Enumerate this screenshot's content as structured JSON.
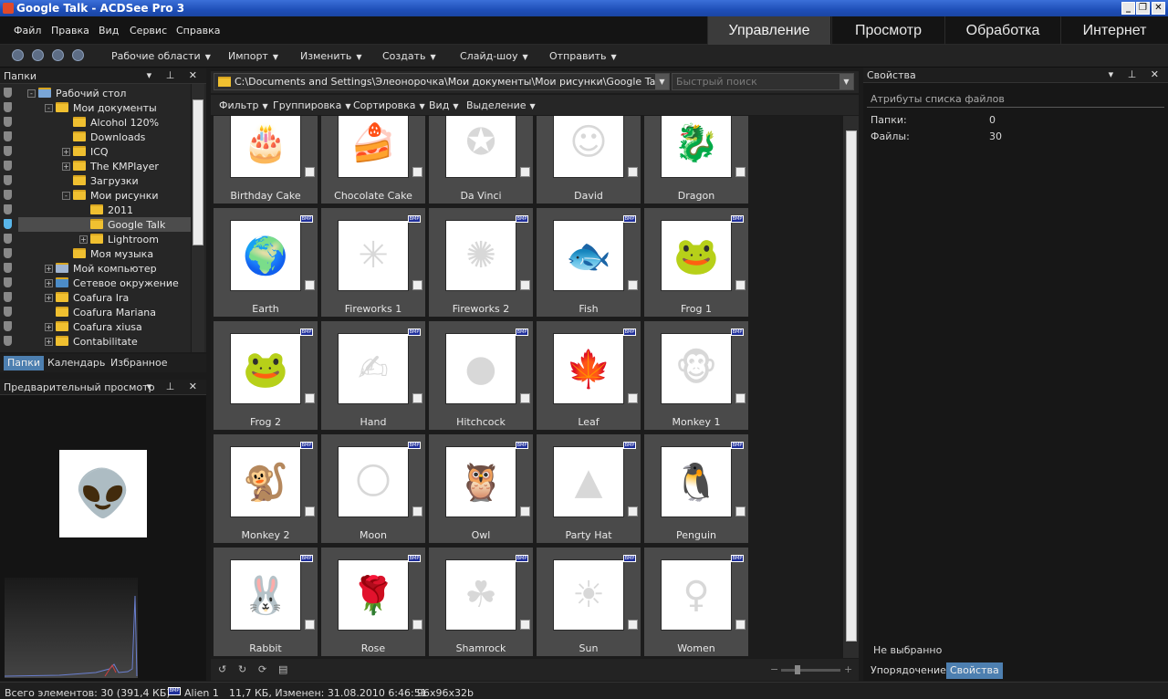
{
  "window": {
    "title": "Google Talk - ACDSee Pro 3"
  },
  "menu": [
    "Файл",
    "Правка",
    "Вид",
    "Сервис",
    "Справка"
  ],
  "modes": [
    "Управление",
    "Просмотр",
    "Обработка",
    "Интернет"
  ],
  "toolbar": [
    "Рабочие области",
    "Импорт",
    "Изменить",
    "Создать",
    "Слайд-шоу",
    "Отправить"
  ],
  "folders_panel": {
    "title": "Папки",
    "tree": [
      {
        "label": "Рабочий стол",
        "level": 0,
        "expander": "-",
        "icon": "desktop"
      },
      {
        "label": "Мои документы",
        "level": 1,
        "expander": "-",
        "icon": "docs"
      },
      {
        "label": "Alcohol 120%",
        "level": 2,
        "expander": "",
        "icon": "folder"
      },
      {
        "label": "Downloads",
        "level": 2,
        "expander": "",
        "icon": "folder"
      },
      {
        "label": "ICQ",
        "level": 2,
        "expander": "+",
        "icon": "folder"
      },
      {
        "label": "The KMPlayer",
        "level": 2,
        "expander": "+",
        "icon": "folder"
      },
      {
        "label": "Загрузки",
        "level": 2,
        "expander": "",
        "icon": "folder"
      },
      {
        "label": "Мои рисунки",
        "level": 2,
        "expander": "-",
        "icon": "pics"
      },
      {
        "label": "2011",
        "level": 3,
        "expander": "",
        "icon": "folder"
      },
      {
        "label": "Google Talk",
        "level": 3,
        "expander": "",
        "icon": "folder",
        "selected": true
      },
      {
        "label": "Lightroom",
        "level": 3,
        "expander": "+",
        "icon": "folder"
      },
      {
        "label": "Моя музыка",
        "level": 2,
        "expander": "",
        "icon": "music"
      },
      {
        "label": "Мой компьютер",
        "level": 1,
        "expander": "+",
        "icon": "computer"
      },
      {
        "label": "Сетевое окружение",
        "level": 1,
        "expander": "+",
        "icon": "network"
      },
      {
        "label": "Coafura Ira",
        "level": 1,
        "expander": "+",
        "icon": "folder"
      },
      {
        "label": "Coafura Mariana",
        "level": 1,
        "expander": "",
        "icon": "folder"
      },
      {
        "label": "Coafura xiusa",
        "level": 1,
        "expander": "+",
        "icon": "folder"
      },
      {
        "label": "Contabilitate",
        "level": 1,
        "expander": "+",
        "icon": "folder"
      }
    ],
    "tabs": [
      "Папки",
      "Календарь",
      "Избранное"
    ]
  },
  "preview_panel": {
    "title": "Предварительный просмотр"
  },
  "path": "C:\\Documents and Settings\\Элеонорочка\\Мои документы\\Мои рисунки\\Google Talk",
  "search_placeholder": "Быстрый поиск",
  "filters": [
    "Фильтр",
    "Группировка",
    "Сортировка",
    "Вид",
    "Выделение"
  ],
  "files": [
    {
      "name": "Birthday Cake",
      "glyph": "🎂"
    },
    {
      "name": "Chocolate Cake",
      "glyph": "🍰"
    },
    {
      "name": "Da Vinci",
      "glyph": "✪"
    },
    {
      "name": "David",
      "glyph": "☺"
    },
    {
      "name": "Dragon",
      "glyph": "🐉"
    },
    {
      "name": "Earth",
      "glyph": "🌍"
    },
    {
      "name": "Fireworks 1",
      "glyph": "✳"
    },
    {
      "name": "Fireworks 2",
      "glyph": "✺"
    },
    {
      "name": "Fish",
      "glyph": "🐟"
    },
    {
      "name": "Frog 1",
      "glyph": "🐸"
    },
    {
      "name": "Frog 2",
      "glyph": "🐸"
    },
    {
      "name": "Hand",
      "glyph": "✍"
    },
    {
      "name": "Hitchcock",
      "glyph": "●"
    },
    {
      "name": "Leaf",
      "glyph": "🍁"
    },
    {
      "name": "Monkey 1",
      "glyph": "🐵"
    },
    {
      "name": "Monkey 2",
      "glyph": "🐒"
    },
    {
      "name": "Moon",
      "glyph": "🌕"
    },
    {
      "name": "Owl",
      "glyph": "🦉"
    },
    {
      "name": "Party Hat",
      "glyph": "▲"
    },
    {
      "name": "Penguin",
      "glyph": "🐧"
    },
    {
      "name": "Rabbit",
      "glyph": "🐰"
    },
    {
      "name": "Rose",
      "glyph": "🌹"
    },
    {
      "name": "Shamrock",
      "glyph": "☘"
    },
    {
      "name": "Sun",
      "glyph": "☀"
    },
    {
      "name": "Women",
      "glyph": "♀"
    }
  ],
  "file_badge": "BMP",
  "properties": {
    "title": "Свойства",
    "section": "Атрибуты списка файлов",
    "folders_label": "Папки:",
    "folders_value": "0",
    "files_label": "Файлы:",
    "files_value": "30",
    "not_selected": "Не выбранно",
    "tabs": [
      "Упорядочение",
      "Свойства"
    ]
  },
  "status": {
    "total": "Всего элементов: 30  (391,4 КБ)",
    "badge": "BMP",
    "current": "Alien 1",
    "info": "11,7 КБ, Изменен: 31.08.2010 6:46:51",
    "dims": "96x96x32b"
  }
}
